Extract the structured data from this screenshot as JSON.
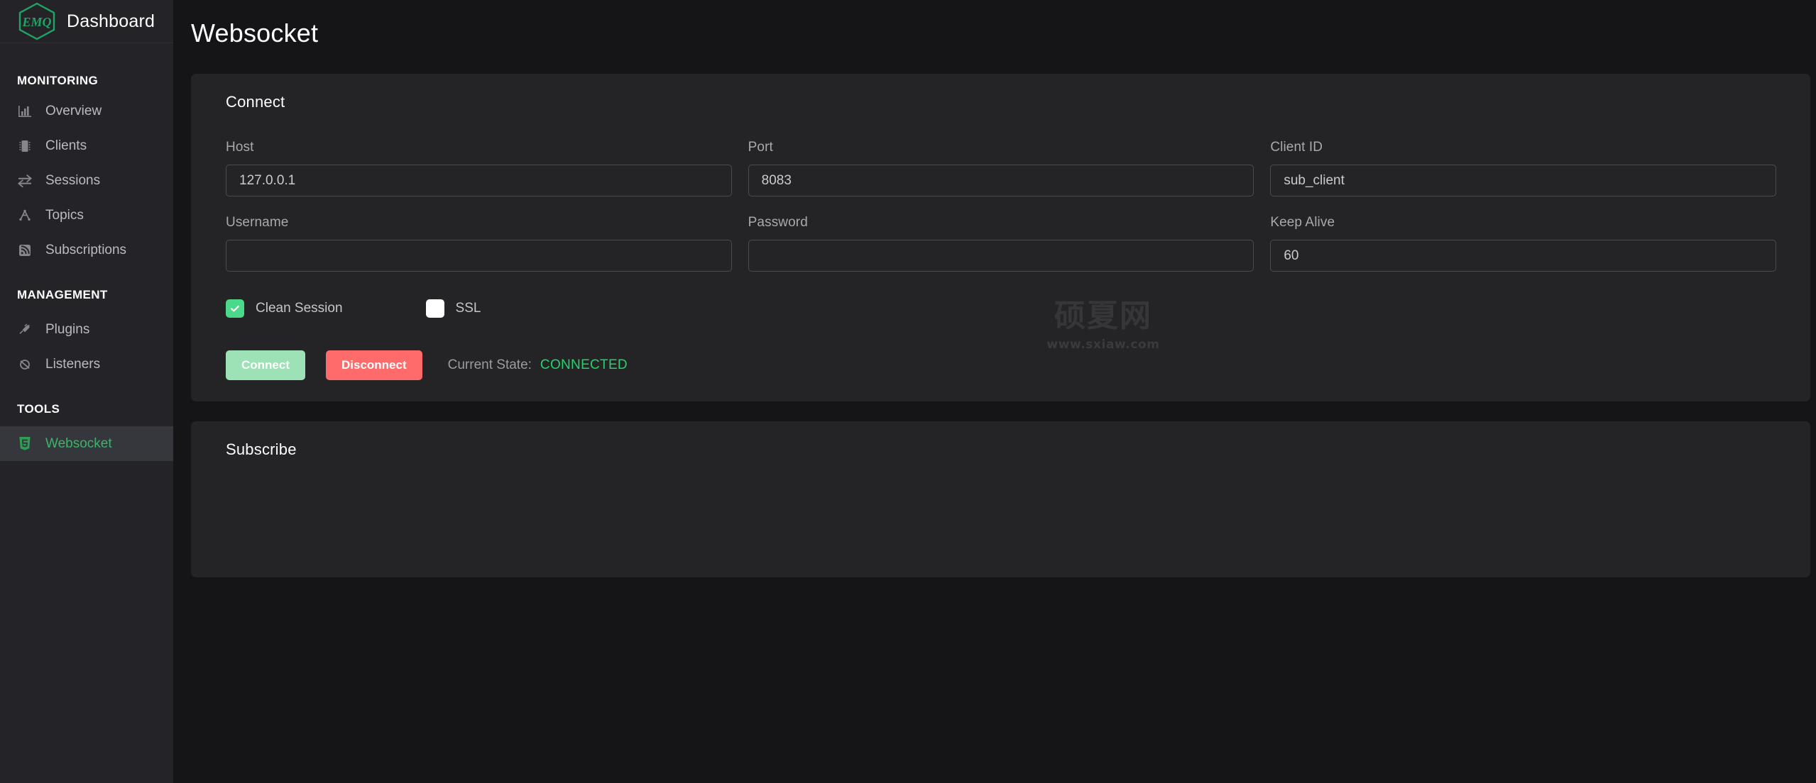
{
  "brand": {
    "logo_text": "EMQ",
    "title": "Dashboard",
    "logo_color": "#21a366"
  },
  "sidebar": {
    "sections": [
      {
        "label": "MONITORING",
        "items": [
          {
            "label": "Overview",
            "icon": "bar-chart-icon",
            "active": false
          },
          {
            "label": "Clients",
            "icon": "chip-icon",
            "active": false
          },
          {
            "label": "Sessions",
            "icon": "exchange-arrows-icon",
            "active": false
          },
          {
            "label": "Topics",
            "icon": "topic-tree-icon",
            "active": false
          },
          {
            "label": "Subscriptions",
            "icon": "rss-icon",
            "active": false
          }
        ]
      },
      {
        "label": "MANAGEMENT",
        "items": [
          {
            "label": "Plugins",
            "icon": "plug-icon",
            "active": false
          },
          {
            "label": "Listeners",
            "icon": "listener-loop-icon",
            "active": false
          }
        ]
      },
      {
        "label": "TOOLS",
        "items": [
          {
            "label": "Websocket",
            "icon": "html5-badge-icon",
            "active": true
          }
        ]
      }
    ]
  },
  "page": {
    "title": "Websocket"
  },
  "connect_panel": {
    "heading": "Connect",
    "fields": [
      {
        "label": "Host",
        "value": "127.0.0.1",
        "placeholder": ""
      },
      {
        "label": "Port",
        "value": "8083",
        "placeholder": ""
      },
      {
        "label": "Client ID",
        "value": "sub_client",
        "placeholder": ""
      },
      {
        "label": "Username",
        "value": "",
        "placeholder": ""
      },
      {
        "label": "Password",
        "value": "",
        "placeholder": ""
      },
      {
        "label": "Keep Alive",
        "value": "60",
        "placeholder": ""
      }
    ],
    "checkboxes": [
      {
        "label": "Clean Session",
        "checked": true
      },
      {
        "label": "SSL",
        "checked": false
      }
    ],
    "connect_button": "Connect",
    "disconnect_button": "Disconnect",
    "state_label": "Current State:",
    "state_value": "CONNECTED",
    "state_color": "#27d16b"
  },
  "subscribe_panel": {
    "heading": "Subscribe"
  },
  "watermark": {
    "text_cn": "硕夏网",
    "url": "www.sxiaw.com"
  }
}
